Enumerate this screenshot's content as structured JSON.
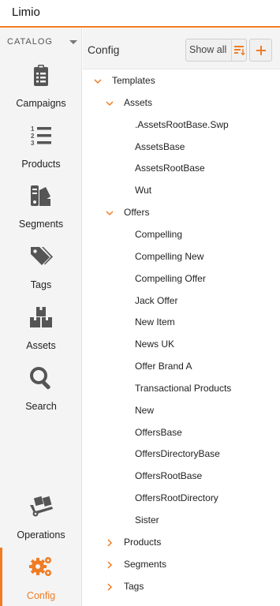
{
  "app": {
    "title": "Limio"
  },
  "sidebar": {
    "catalog_label": "CATALOG",
    "items": [
      {
        "label": "Campaigns",
        "icon": "clipboard-list-icon"
      },
      {
        "label": "Products",
        "icon": "numbered-list-icon"
      },
      {
        "label": "Segments",
        "icon": "swatches-icon"
      },
      {
        "label": "Tags",
        "icon": "tags-icon"
      },
      {
        "label": "Assets",
        "icon": "boxes-icon"
      },
      {
        "label": "Search",
        "icon": "search-icon"
      },
      {
        "label": "Operations",
        "icon": "dolly-icon"
      },
      {
        "label": "Config",
        "icon": "gears-icon",
        "active": true
      }
    ]
  },
  "main": {
    "title": "Config",
    "show_all_label": "Show all",
    "tree": [
      {
        "label": "Templates",
        "expanded": true,
        "depth": 0
      },
      {
        "label": "Assets",
        "expanded": true,
        "depth": 1
      },
      {
        "label": ".AssetsRootBase.Swp",
        "depth": 2
      },
      {
        "label": "AssetsBase",
        "depth": 2
      },
      {
        "label": "AssetsRootBase",
        "depth": 2
      },
      {
        "label": "Wut",
        "depth": 2
      },
      {
        "label": "Offers",
        "expanded": true,
        "depth": 1
      },
      {
        "label": "Compelling",
        "depth": 2
      },
      {
        "label": "Compelling New",
        "depth": 2
      },
      {
        "label": "Compelling Offer",
        "depth": 2
      },
      {
        "label": "Jack Offer",
        "depth": 2
      },
      {
        "label": "New Item",
        "depth": 2
      },
      {
        "label": "News UK",
        "depth": 2
      },
      {
        "label": "Offer Brand A",
        "depth": 2
      },
      {
        "label": "Transactional Products",
        "depth": 2
      },
      {
        "label": "New",
        "depth": 2
      },
      {
        "label": "OffersBase",
        "depth": 2
      },
      {
        "label": "OffersDirectoryBase",
        "depth": 2
      },
      {
        "label": "OffersRootBase",
        "depth": 2
      },
      {
        "label": "OffersRootDirectory",
        "depth": 2
      },
      {
        "label": "Sister",
        "depth": 2
      },
      {
        "label": "Products",
        "expanded": false,
        "depth": 1
      },
      {
        "label": "Segments",
        "expanded": false,
        "depth": 1
      },
      {
        "label": "Tags",
        "expanded": false,
        "depth": 1
      }
    ]
  },
  "colors": {
    "accent": "#f07c24",
    "icon": "#555555",
    "sidebar_bg": "#f4f4f4"
  }
}
